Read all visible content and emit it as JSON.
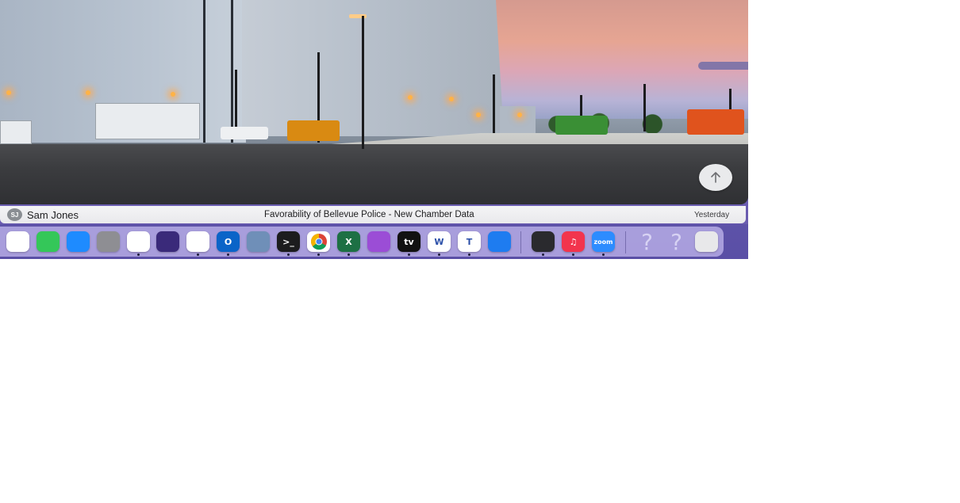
{
  "message": {
    "avatar_initials": "SJ",
    "sender": "Sam Jones",
    "subject": "Favorability of Bellevue Police - New Chamber Data",
    "date": "Yesterday"
  },
  "dock": {
    "items": [
      {
        "name": "photos-icon",
        "label": "",
        "color": "#ffffff",
        "running": false
      },
      {
        "name": "facetime-icon",
        "label": "",
        "color": "#34c759",
        "running": false
      },
      {
        "name": "app-store-icon",
        "label": "",
        "color": "#1e8bff",
        "running": false
      },
      {
        "name": "system-settings-icon",
        "label": "",
        "color": "#8e8e93",
        "running": false
      },
      {
        "name": "slack-icon",
        "label": "",
        "color": "#ffffff",
        "running": true
      },
      {
        "name": "siri-icon",
        "label": "",
        "color": "#3a2a7a",
        "running": false
      },
      {
        "name": "news-icon",
        "label": "",
        "color": "#ffffff",
        "running": true
      },
      {
        "name": "outlook-icon",
        "label": "O",
        "color": "#0a64c8",
        "running": true
      },
      {
        "name": "network-globe-icon",
        "label": "",
        "color": "#6f8fb8",
        "running": false
      },
      {
        "name": "terminal-icon",
        "label": ">_",
        "color": "#1c1c1e",
        "running": true
      },
      {
        "name": "chrome-icon",
        "label": "",
        "color": "#ffffff",
        "running": true
      },
      {
        "name": "excel-icon",
        "label": "X",
        "color": "#1d7044",
        "running": true
      },
      {
        "name": "podcasts-icon",
        "label": "",
        "color": "#9b4dd6",
        "running": false
      },
      {
        "name": "apple-tv-icon",
        "label": "tv",
        "color": "#111111",
        "running": true
      },
      {
        "name": "word-icon",
        "label": "W",
        "color": "#ffffff",
        "running": true
      },
      {
        "name": "teams-icon",
        "label": "T",
        "color": "#ffffff",
        "running": true
      },
      {
        "name": "safari-icon",
        "label": "",
        "color": "#1e7cf0",
        "running": false
      },
      {
        "name": "mountain-logo-app-icon",
        "label": "",
        "color": "#2a2a2e",
        "running": true
      },
      {
        "name": "music-icon",
        "label": "♫",
        "color": "#f2344d",
        "running": true
      },
      {
        "name": "zoom-icon",
        "label": "zoom",
        "color": "#2d8cff",
        "running": true
      },
      {
        "name": "unknown-app-icon",
        "label": "?",
        "color": "#d7d2f3",
        "running": false
      },
      {
        "name": "unknown-app-icon-2",
        "label": "?",
        "color": "#d7d2f3",
        "running": false
      },
      {
        "name": "trash-icon",
        "label": "",
        "color": "#e8e8ea",
        "running": false
      }
    ]
  }
}
